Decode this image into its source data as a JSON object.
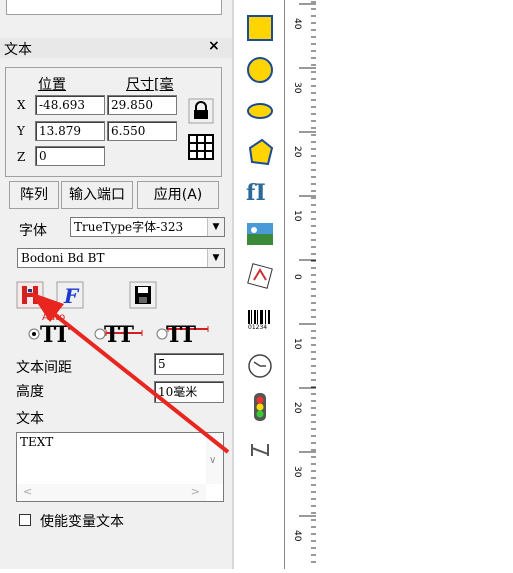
{
  "panel": {
    "title": "文本",
    "close": "×",
    "position": {
      "pos_header": "位置",
      "size_header": "尺寸[毫",
      "x_label": "X",
      "y_label": "Y",
      "z_label": "Z",
      "x_pos": "-48.693",
      "x_size": "29.850",
      "y_pos": "13.879",
      "y_size": "6.550",
      "z_pos": "0"
    },
    "buttons": {
      "array": "阵列",
      "input_port": "输入端口",
      "apply": "应用(A)"
    },
    "font_label": "字体",
    "font_type": "TrueType字体-323",
    "font_name": "Bodoni Bd BT",
    "auto_label": "Auto",
    "tt_glyph": "TT",
    "spacing_label": "文本间距",
    "spacing_value": "5",
    "height_label": "高度",
    "height_value": "10毫米",
    "text_label": "文本",
    "text_value": "TEXT",
    "variable_text_label": "使能变量文本"
  },
  "toolbar": {
    "tools": [
      "rectangle-icon",
      "circle-icon",
      "ellipse-icon",
      "polygon-icon",
      "text-icon",
      "image-icon",
      "vector-file-icon",
      "barcode-icon",
      "clock-icon",
      "traffic-light-icon",
      "delay-icon"
    ],
    "barcode_digits": "01234",
    "text_tool_glyph": "fI"
  },
  "ruler": {
    "labels": [
      "40",
      "30",
      "20",
      "10",
      "0",
      "10",
      "20",
      "30",
      "40"
    ]
  },
  "colors": {
    "panel_bg": "#f0f0f0",
    "tool_yellow": "#ffd400",
    "tool_stroke": "#1a4a9a",
    "arrow_red": "#e8261f",
    "bold_btn_red": "#d32020"
  }
}
